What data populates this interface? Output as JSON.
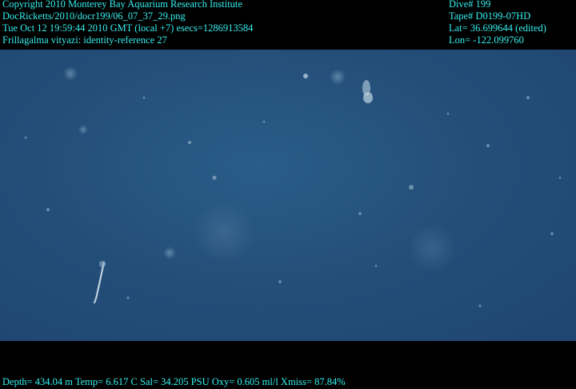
{
  "header_left": {
    "copyright": "Copyright 2010 Monterey Bay Aquarium Research Institute",
    "filename": "DocRicketts/2010/docr199/06_07_37_29.png",
    "timestamp": "Tue Oct 12 19:59:44 2010 GMT (local +7)  esecs=1286913584",
    "identity": "Frillagalma vityazi: identity-reference 27"
  },
  "header_right": {
    "dive": "Dive# 199",
    "tape": "Tape# D0199-07HD",
    "lat": "Lat= 36.699644 (edited)",
    "lon": "Lon= -122.099760"
  },
  "footer": {
    "telemetry": "Depth= 434.04 m  Temp= 6.617 C  Sal= 34.205 PSU  Oxy= 0.605 ml/l  Xmiss= 87.84%"
  },
  "colors": {
    "overlay_text": "#35f0f0",
    "water": "#244f79",
    "background": "#000000"
  }
}
